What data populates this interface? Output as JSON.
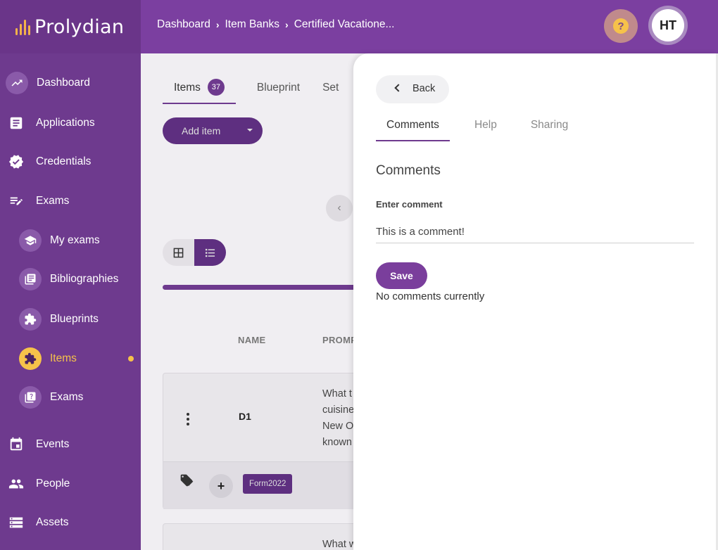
{
  "app": {
    "name": "Prolydian"
  },
  "sidebar": {
    "items": [
      {
        "label": "Dashboard",
        "icon": "trending-up-icon"
      },
      {
        "label": "Applications",
        "icon": "document-icon"
      },
      {
        "label": "Credentials",
        "icon": "verified-badge-icon"
      },
      {
        "label": "Exams",
        "icon": "edit-list-icon"
      },
      {
        "label": "My exams",
        "icon": "graduation-cap-icon"
      },
      {
        "label": "Bibliographies",
        "icon": "library-books-icon"
      },
      {
        "label": "Blueprints",
        "icon": "puzzle-icon"
      },
      {
        "label": "Items",
        "icon": "puzzle-icon",
        "active": true
      },
      {
        "label": "Exams",
        "icon": "quiz-icon"
      },
      {
        "label": "Events",
        "icon": "calendar-icon"
      },
      {
        "label": "People",
        "icon": "people-icon"
      },
      {
        "label": "Assets",
        "icon": "storage-icon"
      }
    ]
  },
  "header": {
    "breadcrumb": [
      "Dashboard",
      "Item Banks",
      "Certified Vacatione..."
    ],
    "help_icon": "help-icon",
    "avatar_initials": "HT"
  },
  "main": {
    "tabs": [
      {
        "label": "Items",
        "count": "37"
      },
      {
        "label": "Blueprint"
      },
      {
        "label": "Set"
      }
    ],
    "add_item_label": "Add item",
    "columns": [
      "NAME",
      "PROMP"
    ],
    "rows": [
      {
        "name": "D1",
        "prompt": "What t\ncuisine\nNew O\nknown",
        "tag": "Form2022"
      },
      {
        "prompt": "What w"
      }
    ]
  },
  "panel": {
    "back_label": "Back",
    "tabs": [
      "Comments",
      "Help",
      "Sharing"
    ],
    "section_title": "Comments",
    "comment_label": "Enter comment",
    "comment_value": "This is a comment!",
    "save_label": "Save",
    "empty_text": "No comments currently"
  },
  "colors": {
    "sidebar": "#6e3a8e",
    "topbar": "#7b3fa0",
    "accent": "#f6c24a",
    "primary": "#7a3e9c"
  }
}
